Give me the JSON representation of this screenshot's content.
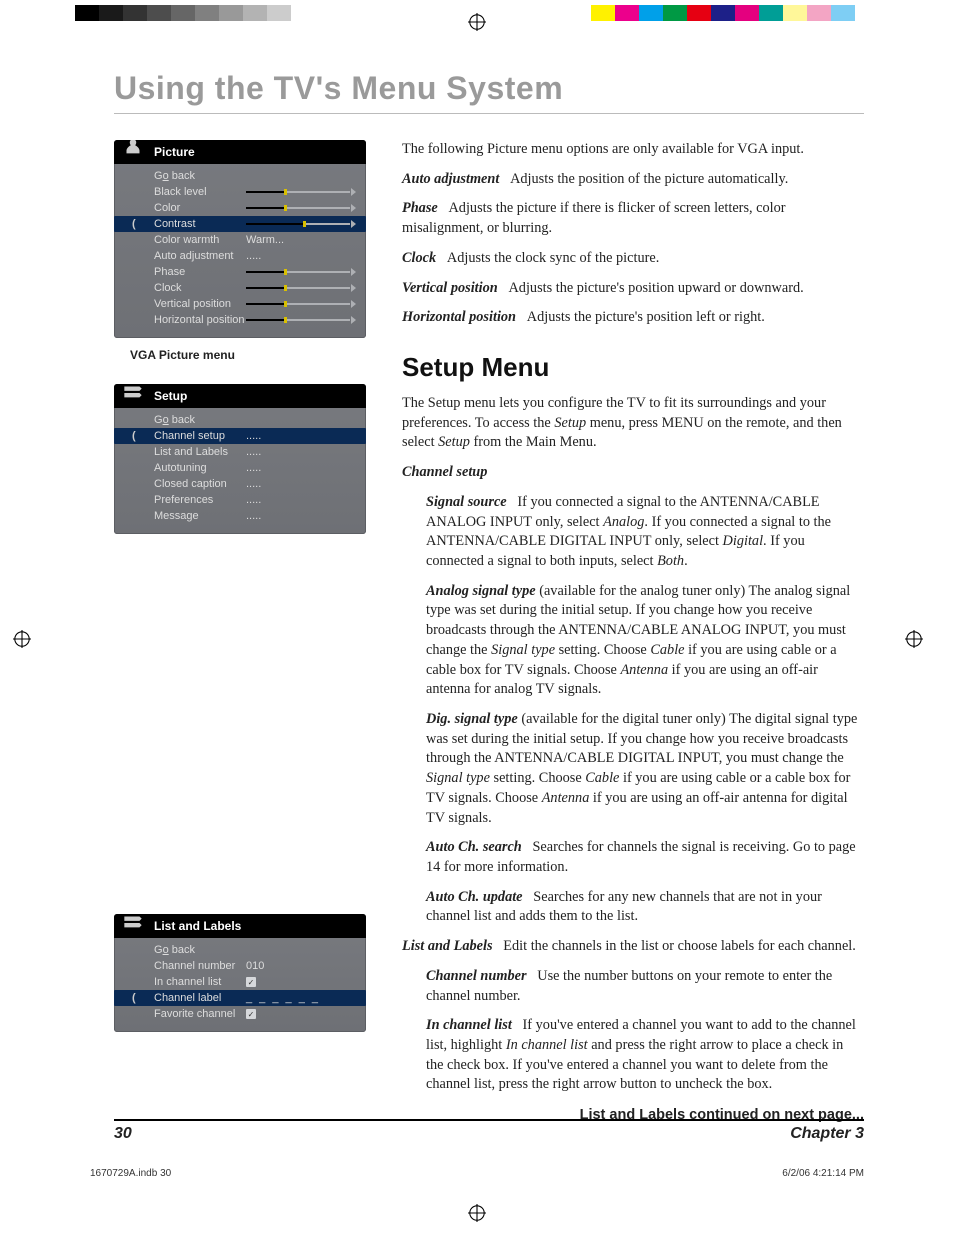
{
  "page_title": "Using the TV's Menu System",
  "color_bar_left": [
    "#000000",
    "#1a1a1a",
    "#333333",
    "#4d4d4d",
    "#666666",
    "#808080",
    "#999999",
    "#b3b3b3",
    "#cccccc",
    "#ffffff"
  ],
  "color_bar_right": [
    "#fff100",
    "#ec008c",
    "#00a0e9",
    "#009944",
    "#e60012",
    "#1d2088",
    "#e4007f",
    "#009e96",
    "#fff799",
    "#f3a5c4",
    "#7ecef4",
    "#ffffff"
  ],
  "osd_picture": {
    "title": "Picture",
    "caption": "VGA Picture menu",
    "rows": [
      {
        "label_pre": "G",
        "label_under": "o",
        "label_post": " back",
        "type": "text",
        "value": ""
      },
      {
        "label": "Black level",
        "type": "slider",
        "fill": 37,
        "knob": 37
      },
      {
        "label": "Color",
        "type": "slider",
        "fill": 37,
        "knob": 37
      },
      {
        "label": "Contrast",
        "type": "slider",
        "fill": 55,
        "knob": 55,
        "highlight": true
      },
      {
        "label": "Color warmth",
        "type": "text",
        "value": "Warm..."
      },
      {
        "label": "Auto adjustment",
        "type": "text",
        "value": "....."
      },
      {
        "label": "Phase",
        "type": "slider",
        "fill": 37,
        "knob": 37
      },
      {
        "label": "Clock",
        "type": "slider",
        "fill": 37,
        "knob": 37
      },
      {
        "label": "Vertical position",
        "type": "slider",
        "fill": 37,
        "knob": 37
      },
      {
        "label": "Horizontal position",
        "type": "slider",
        "fill": 37,
        "knob": 37
      }
    ]
  },
  "osd_setup": {
    "title": "Setup",
    "rows": [
      {
        "label_pre": "G",
        "label_under": "o",
        "label_post": " back",
        "type": "text",
        "value": ""
      },
      {
        "label": "Channel setup",
        "type": "text",
        "value": ".....",
        "highlight": true
      },
      {
        "label": "List and Labels",
        "type": "text",
        "value": "....."
      },
      {
        "label": "Autotuning",
        "type": "text",
        "value": "....."
      },
      {
        "label": "Closed caption",
        "type": "text",
        "value": "....."
      },
      {
        "label": "Preferences",
        "type": "text",
        "value": "....."
      },
      {
        "label": "Message",
        "type": "text",
        "value": "....."
      }
    ]
  },
  "osd_list": {
    "title": "List and Labels",
    "rows": [
      {
        "label_pre": "G",
        "label_under": "o",
        "label_post": " back",
        "type": "text",
        "value": ""
      },
      {
        "label": "Channel number",
        "type": "text",
        "value": "010"
      },
      {
        "label": "In channel list",
        "type": "check",
        "checked": true
      },
      {
        "label": "Channel label",
        "type": "dash",
        "value": "_ _ _ _ _ _",
        "highlight": true
      },
      {
        "label": "Favorite channel",
        "type": "check",
        "checked": true
      }
    ]
  },
  "intro_vga": "The following Picture menu options are only available for VGA input.",
  "defs": {
    "auto_adj": {
      "term": "Auto adjustment",
      "body": "Adjusts the position of the picture automatically."
    },
    "phase": {
      "term": "Phase",
      "body": "Adjusts the picture if there is flicker of screen letters, color misalignment, or blurring."
    },
    "clock": {
      "term": "Clock",
      "body": "Adjusts the clock sync of the picture."
    },
    "vpos": {
      "term": "Vertical position",
      "body": "Adjusts the picture's position upward or downward."
    },
    "hpos": {
      "term": "Horizontal position",
      "body": "Adjusts the picture's position left or right."
    }
  },
  "setup_heading": "Setup Menu",
  "setup_intro_a": "The Setup menu lets you configure the TV to fit its surroundings and your preferences. To access the ",
  "setup_intro_b": "Setup",
  "setup_intro_c": " menu, press MENU on the remote, and then select ",
  "setup_intro_d": "Setup",
  "setup_intro_e": " from the Main Menu.",
  "channel_setup_h": "Channel setup",
  "signal_source": {
    "term": "Signal source",
    "body_a": "If you connected a signal to the ANTENNA/CABLE ANALOG INPUT only, select ",
    "i1": "Analog",
    "body_b": ". If you connected a signal to the ANTENNA/CABLE DIGITAL INPUT only, select ",
    "i2": "Digital",
    "body_c": ". If you connected a signal to both inputs, select ",
    "i3": "Both",
    "body_d": "."
  },
  "analog_sig": {
    "term": "Analog signal type",
    "note": " (available for the analog tuner only)   ",
    "body_a": "The analog signal type was set during the initial setup. If you change how you receive broadcasts through the ANTENNA/CABLE ANALOG INPUT, you must change the ",
    "i1": "Signal type",
    "body_b": " setting. Choose ",
    "i2": "Cable",
    "body_c": " if you are using cable or a cable box for TV signals. Choose ",
    "i3": "Antenna",
    "body_d": " if you are using an off-air antenna for analog TV signals."
  },
  "dig_sig": {
    "term": "Dig. signal type",
    "note": " (available for the digital tuner only)   ",
    "body_a": "The digital signal type was set during the initial setup. If you change how you receive broadcasts through the ANTENNA/CABLE DIGITAL INPUT, you must change the ",
    "i1": "Signal type",
    "body_b": " setting. Choose ",
    "i2": "Cable",
    "body_c": " if you are using cable or a cable box for TV signals. Choose ",
    "i3": "Antenna",
    "body_d": " if you are using an off-air antenna for digital TV signals."
  },
  "auto_search": {
    "term": "Auto Ch. search",
    "body": "Searches for channels the signal is receiving. Go to page 14 for more information."
  },
  "auto_update": {
    "term": "Auto Ch. update",
    "body": "Searches for any new channels that are not in your channel list and adds them to the list."
  },
  "list_labels": {
    "term": "List and Labels",
    "body": "Edit the channels in the list or choose labels for each channel."
  },
  "chan_num": {
    "term": "Channel number",
    "body": "Use the number buttons on your remote to enter the channel number."
  },
  "in_list": {
    "term": "In channel list",
    "body_a": "If you've entered a channel you want to add to the channel list, highlight ",
    "i1": "In channel list",
    "body_b": " and press the right arrow to place a check in the check box. If you've entered a channel you want to delete from the channel list, press the right arrow button to uncheck the box."
  },
  "cont_note": "List and Labels continued on next page...",
  "footer": {
    "page": "30",
    "chapter": "Chapter 3"
  },
  "print_footer": {
    "file": "1670729A.indb   30",
    "ts": "6/2/06   4:21:14 PM"
  }
}
